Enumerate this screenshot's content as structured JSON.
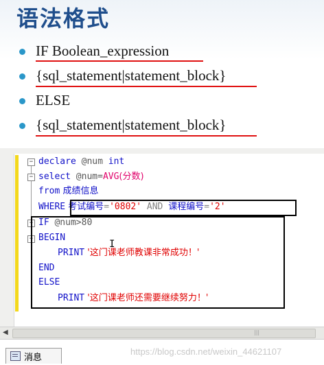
{
  "slide": {
    "title": "语法格式",
    "bullets": [
      {
        "text": "IF Boolean_expression"
      },
      {
        "text": "{sql_statement|statement_block}"
      },
      {
        "text": "ELSE"
      },
      {
        "text": "{sql_statement|statement_block}"
      }
    ]
  },
  "code": {
    "l1_kw": "declare",
    "l1_var": " @num ",
    "l1_type": "int",
    "l2_kw": "select",
    "l2_var": " @num=",
    "l2_fn": "AVG",
    "l2_arg": "(分数)",
    "l3_kw": "from",
    "l3_tbl": " 成绩信息",
    "l4_kw": "WHERE",
    "l4_col1": " 考试编号",
    "l4_eq1": "=",
    "l4_val1": "'0802'",
    "l4_and": " AND ",
    "l4_col2": "课程编号",
    "l4_eq2": "=",
    "l4_val2": "'2'",
    "l5_kw": "IF",
    "l5_var": " @num",
    "l5_op": ">80",
    "l6_kw": "BEGIN",
    "l7_kw": "PRINT",
    "l7_str": " '这门课老师教课非常成功！'",
    "l8_kw": "END",
    "l9_kw": "ELSE",
    "l10_kw": "PRINT",
    "l10_str": " '这门课老师还需要继续努力！'"
  },
  "bottom": {
    "tab_label": "消息",
    "watermark": "https://blog.csdn.net/weixin_44621107"
  },
  "colors": {
    "title": "#1f4e8c",
    "bullet_dot": "#2a97c9",
    "underline": "#e01010",
    "keyword": "#1010c8",
    "function": "#e0006a",
    "string": "#e00000",
    "gutter_change": "#f3d81c"
  }
}
